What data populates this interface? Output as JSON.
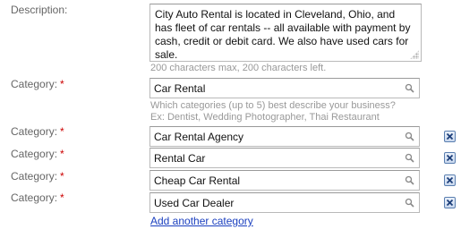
{
  "description": {
    "label": "Description:",
    "value": "City Auto Rental is located in Cleveland, Ohio, and has fleet of car rentals -- all available with payment by cash, credit or debit card. We also have used cars for sale.",
    "char_hint": "200 characters max, 200 characters left."
  },
  "primary_category": {
    "label": "Category:",
    "required_marker": "*",
    "value": "Car Rental",
    "hint_line1": "Which categories (up to 5) best describe your business?",
    "hint_line2": "Ex: Dentist, Wedding Photographer, Thai Restaurant"
  },
  "extra_categories": [
    {
      "label": "Category:",
      "required_marker": "*",
      "value": "Car Rental Agency"
    },
    {
      "label": "Category:",
      "required_marker": "*",
      "value": "Rental Car"
    },
    {
      "label": "Category:",
      "required_marker": "*",
      "value": "Cheap Car Rental"
    },
    {
      "label": "Category:",
      "required_marker": "*",
      "value": "Used Car Dealer"
    }
  ],
  "add_link": "Add another category",
  "icons": {
    "search": "magnifier-icon",
    "remove": "remove-x-icon"
  },
  "colors": {
    "required": "#cc0000",
    "link": "#1a3fbf",
    "hint": "#999999"
  }
}
